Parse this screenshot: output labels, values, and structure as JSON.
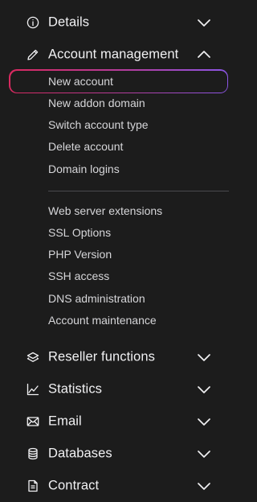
{
  "nav": {
    "details": {
      "label": "Details",
      "icon": "info-icon",
      "expanded": false
    },
    "account_management": {
      "label": "Account management",
      "icon": "pencil-icon",
      "expanded": true,
      "active_item": "New account",
      "group1": [
        "New account",
        "New addon domain",
        "Switch account type",
        "Delete account",
        "Domain logins"
      ],
      "group2": [
        "Web server extensions",
        "SSL Options",
        "PHP Version",
        "SSH access",
        "DNS administration",
        "Account maintenance"
      ]
    },
    "reseller": {
      "label": "Reseller functions",
      "icon": "layers-icon",
      "expanded": false
    },
    "statistics": {
      "label": "Statistics",
      "icon": "line-chart-icon",
      "expanded": false
    },
    "email": {
      "label": "Email",
      "icon": "envelope-icon",
      "expanded": false
    },
    "databases": {
      "label": "Databases",
      "icon": "database-icon",
      "expanded": false
    },
    "contract": {
      "label": "Contract",
      "icon": "document-icon",
      "expanded": false
    }
  },
  "colors": {
    "background": "#1c1c1c",
    "text": "#f1f1f3",
    "active_gradient_start": "#d9295f",
    "active_gradient_end": "#8c56e6"
  }
}
